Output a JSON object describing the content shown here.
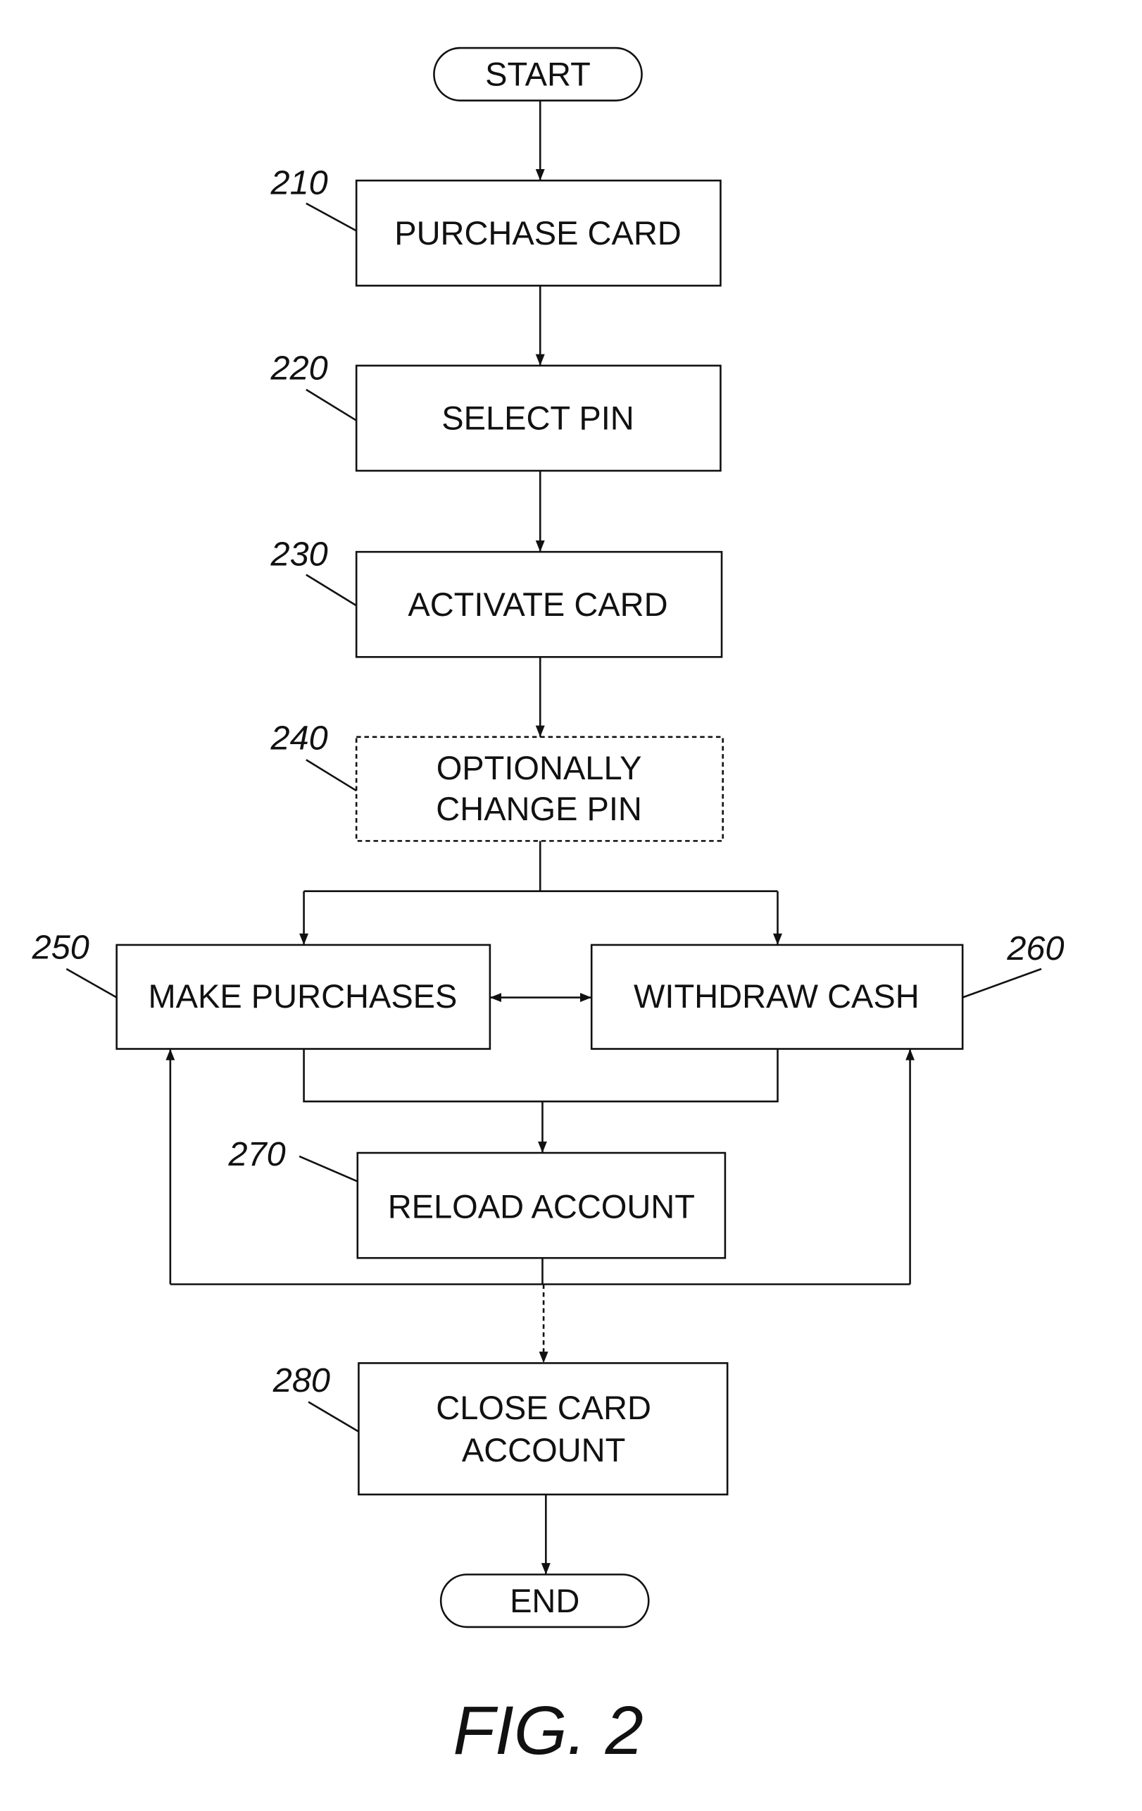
{
  "diagram": {
    "type": "flowchart",
    "terminals": {
      "start": "START",
      "end": "END"
    },
    "steps": [
      {
        "id": "210",
        "lines": [
          "PURCHASE CARD"
        ],
        "optional": false
      },
      {
        "id": "220",
        "lines": [
          "SELECT PIN"
        ],
        "optional": false
      },
      {
        "id": "230",
        "lines": [
          "ACTIVATE CARD"
        ],
        "optional": false
      },
      {
        "id": "240",
        "lines": [
          "OPTIONALLY",
          "CHANGE PIN"
        ],
        "optional": true
      },
      {
        "id": "250",
        "lines": [
          "MAKE PURCHASES"
        ],
        "optional": false
      },
      {
        "id": "260",
        "lines": [
          "WITHDRAW CASH"
        ],
        "optional": false
      },
      {
        "id": "270",
        "lines": [
          "RELOAD ACCOUNT"
        ],
        "optional": false
      },
      {
        "id": "280",
        "lines": [
          "CLOSE CARD",
          "ACCOUNT"
        ],
        "optional": false
      }
    ],
    "edges": [
      [
        "START",
        "210"
      ],
      [
        "210",
        "220"
      ],
      [
        "220",
        "230"
      ],
      [
        "230",
        "240"
      ],
      [
        "240",
        "250"
      ],
      [
        "240",
        "260"
      ],
      [
        "250",
        "260"
      ],
      [
        "260",
        "250"
      ],
      [
        "250",
        "270"
      ],
      [
        "260",
        "270"
      ],
      [
        "270",
        "250"
      ],
      [
        "270",
        "260"
      ],
      [
        "270",
        "280"
      ],
      [
        "280",
        "END"
      ]
    ],
    "figure_label": "FIG. 2"
  }
}
